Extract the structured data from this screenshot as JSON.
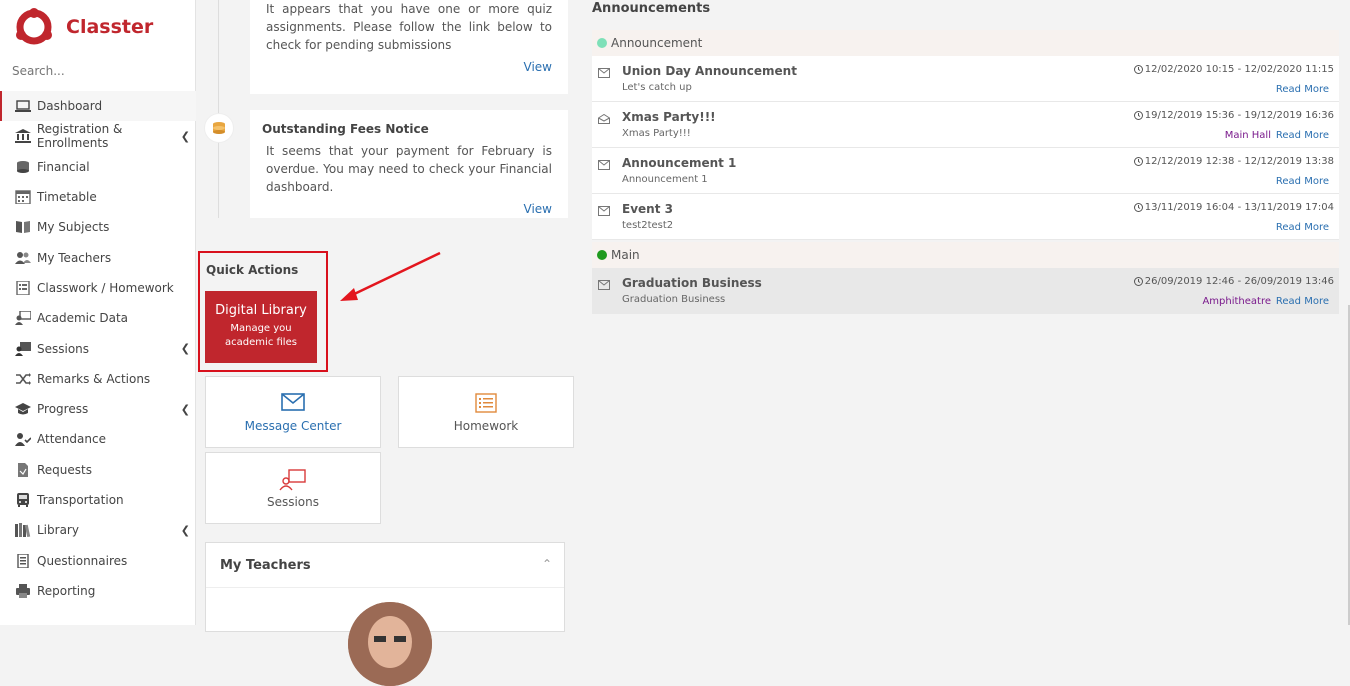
{
  "app": {
    "name": "Classter"
  },
  "search": {
    "placeholder": "Search..."
  },
  "sidebar": {
    "items": [
      {
        "label": "Dashboard"
      },
      {
        "label": "Registration & Enrollments"
      },
      {
        "label": "Financial"
      },
      {
        "label": "Timetable"
      },
      {
        "label": "My Subjects"
      },
      {
        "label": "My Teachers"
      },
      {
        "label": "Classwork / Homework"
      },
      {
        "label": "Academic Data"
      },
      {
        "label": "Sessions"
      },
      {
        "label": "Remarks & Actions"
      },
      {
        "label": "Progress"
      },
      {
        "label": "Attendance"
      },
      {
        "label": "Requests"
      },
      {
        "label": "Transportation"
      },
      {
        "label": "Library"
      },
      {
        "label": "Questionnaires"
      },
      {
        "label": "Reporting"
      }
    ]
  },
  "notices": [
    {
      "title": "",
      "body": "It appears that you have one or more quiz assignments. Please follow the link below to check for pending submissions",
      "link": "View"
    },
    {
      "title": "Outstanding Fees Notice",
      "body": "It seems that your payment for February is overdue. You may need to check your Financial dashboard.",
      "link": "View"
    }
  ],
  "quick_actions": {
    "title": "Quick Actions",
    "digital_library": {
      "title": "Digital Library",
      "subtitle": "Manage you academic files"
    },
    "tiles": [
      {
        "label": "Message Center",
        "color": "#2a6fb0"
      },
      {
        "label": "Homework",
        "color": "#e08a3c"
      },
      {
        "label": "Sessions",
        "color": "#d83a3a"
      }
    ]
  },
  "my_teachers": {
    "title": "My Teachers"
  },
  "announcements": {
    "title": "Announcements",
    "groups": [
      {
        "name": "Announcement",
        "color": "#7ee0b8",
        "items": [
          {
            "title": "Union Day Announcement",
            "subtitle": "Let's catch up",
            "date": "12/02/2020 10:15 - 12/02/2020 11:15",
            "location": "",
            "more": "Read More"
          },
          {
            "title": "Xmas Party!!!",
            "subtitle": "Xmas Party!!!",
            "date": "19/12/2019 15:36 - 19/12/2019 16:36",
            "location": "Main Hall",
            "more": "Read More"
          },
          {
            "title": "Announcement 1",
            "subtitle": "Announcement 1",
            "date": "12/12/2019 12:38 - 12/12/2019 13:38",
            "location": "",
            "more": "Read More"
          },
          {
            "title": "Event 3",
            "subtitle": "test2test2",
            "date": "13/11/2019 16:04 - 13/11/2019 17:04",
            "location": "",
            "more": "Read More"
          }
        ]
      },
      {
        "name": "Main",
        "color": "#1f9a1f",
        "items": [
          {
            "title": "Graduation Business",
            "subtitle": "Graduation Business",
            "date": "26/09/2019 12:46 - 26/09/2019 13:46",
            "location": "Amphitheatre",
            "more": "Read More"
          }
        ]
      }
    ]
  }
}
